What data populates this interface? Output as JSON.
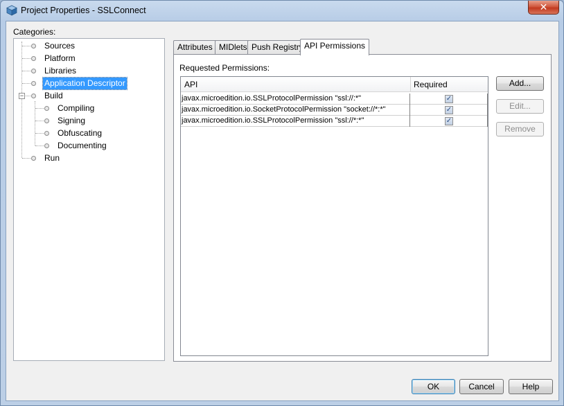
{
  "window": {
    "title": "Project Properties - SSLConnect"
  },
  "categories": {
    "label": "Categories:",
    "items": [
      {
        "label": "Sources",
        "level": 1
      },
      {
        "label": "Platform",
        "level": 1
      },
      {
        "label": "Libraries",
        "level": 1
      },
      {
        "label": "Application Descriptor",
        "level": 1,
        "selected": true
      },
      {
        "label": "Build",
        "level": 1,
        "expanded": true
      },
      {
        "label": "Compiling",
        "level": 2
      },
      {
        "label": "Signing",
        "level": 2
      },
      {
        "label": "Obfuscating",
        "level": 2
      },
      {
        "label": "Documenting",
        "level": 2
      },
      {
        "label": "Run",
        "level": 1
      }
    ]
  },
  "tabs": [
    {
      "label": "Attributes"
    },
    {
      "label": "MIDlets"
    },
    {
      "label": "Push Registry"
    },
    {
      "label": "API Permissions",
      "active": true
    }
  ],
  "permissions": {
    "label": "Requested Permissions:",
    "columns": [
      "API",
      "Required"
    ],
    "rows": [
      {
        "api": "javax.microedition.io.SSLProtocolPermission \"ssl://:*\"",
        "required": true
      },
      {
        "api": "javax.microedition.io.SocketProtocolPermission \"socket://*:*\"",
        "required": true
      },
      {
        "api": "javax.microedition.io.SSLProtocolPermission \"ssl://*:*\"",
        "required": true
      }
    ],
    "buttons": {
      "add": "Add...",
      "edit": "Edit...",
      "remove": "Remove"
    }
  },
  "dialog_buttons": {
    "ok": "OK",
    "cancel": "Cancel",
    "help": "Help"
  },
  "icons": {
    "app": "netbeans-cube-icon",
    "close": "close-icon",
    "checkbox": "check-icon"
  },
  "colors": {
    "selection": "#3399ff",
    "titlebar": "#c9daee",
    "close_button": "#c23a20"
  }
}
